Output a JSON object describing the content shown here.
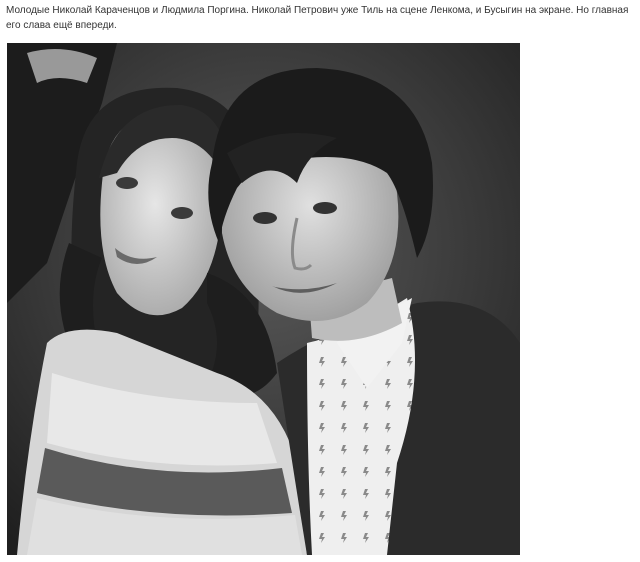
{
  "article": {
    "caption": "Молодые Николай Караченцов и Людмила Поргина. Николай Петрович уже Тиль на сцене Ленкома, и Бусыгин на экране. Но главная его слава ещё впереди."
  },
  "photo": {
    "style": "black-and-white",
    "palette": {
      "bg": "#2e2e2e",
      "hair": "#1a1a1a",
      "skin": "#cfcfcf",
      "shirt": "#ececec",
      "jacket": "#2a2a2a"
    }
  }
}
